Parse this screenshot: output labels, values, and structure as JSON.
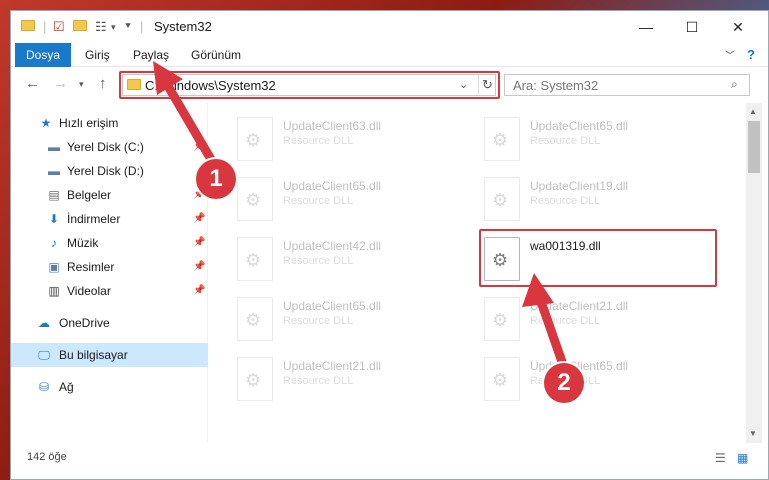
{
  "window": {
    "title": "System32",
    "minimize_glyph": "—",
    "maximize_glyph": "☐",
    "close_glyph": "✕"
  },
  "ribbon": {
    "tabs": [
      "Dosya",
      "Giriş",
      "Paylaş",
      "Görünüm"
    ],
    "active_tab": "Dosya",
    "accent_color": "#1979ca"
  },
  "address": {
    "path": "C:\\Windows\\System32",
    "search_placeholder": "Ara: System32"
  },
  "sidebar": {
    "items": [
      {
        "label": "Hızlı erişim",
        "icon": "star-icon",
        "pinned": false
      },
      {
        "label": "Yerel Disk (C:)",
        "icon": "drive-icon",
        "pinned": true
      },
      {
        "label": "Yerel Disk (D:)",
        "icon": "drive-icon",
        "pinned": false
      },
      {
        "label": "Belgeler",
        "icon": "documents-icon",
        "pinned": true
      },
      {
        "label": "İndirmeler",
        "icon": "download-icon",
        "pinned": true
      },
      {
        "label": "Müzik",
        "icon": "music-icon",
        "pinned": true
      },
      {
        "label": "Resimler",
        "icon": "pictures-icon",
        "pinned": true
      },
      {
        "label": "Videolar",
        "icon": "videos-icon",
        "pinned": true
      },
      {
        "label": "OneDrive",
        "icon": "cloud-icon",
        "pinned": false
      },
      {
        "label": "Bu bilgisayar",
        "icon": "computer-icon",
        "pinned": false
      },
      {
        "label": "Ağ",
        "icon": "network-icon",
        "pinned": false
      }
    ],
    "selected": "Bu bilgisayar"
  },
  "files": {
    "left": [
      {
        "name": "UpdateClient63.dll",
        "type": "Resource DLL"
      },
      {
        "name": "UpdateClient65.dll",
        "type": "Resource DLL"
      },
      {
        "name": "UpdateClient42.dll",
        "type": "Resource DLL"
      },
      {
        "name": "UpdateClient65.dll",
        "type": "Resource DLL"
      },
      {
        "name": "UpdateClient21.dll",
        "type": "Resource DLL"
      }
    ],
    "right": [
      {
        "name": "UpdateClient65.dll",
        "type": "Resource DLL"
      },
      {
        "name": "UpdateClient19.dll",
        "type": "Resource DLL"
      },
      {
        "name": "wa001319.dll",
        "type": ""
      },
      {
        "name": "UpdateClient21.dll",
        "type": "Resource DLL"
      },
      {
        "name": "UpdateClient65.dll",
        "type": "Resource DLL"
      }
    ],
    "highlighted": "wa001319.dll"
  },
  "status": {
    "count_text": "142 öğe"
  },
  "annotations": {
    "badge1": "1",
    "badge2": "2",
    "color": "#d9373f"
  }
}
